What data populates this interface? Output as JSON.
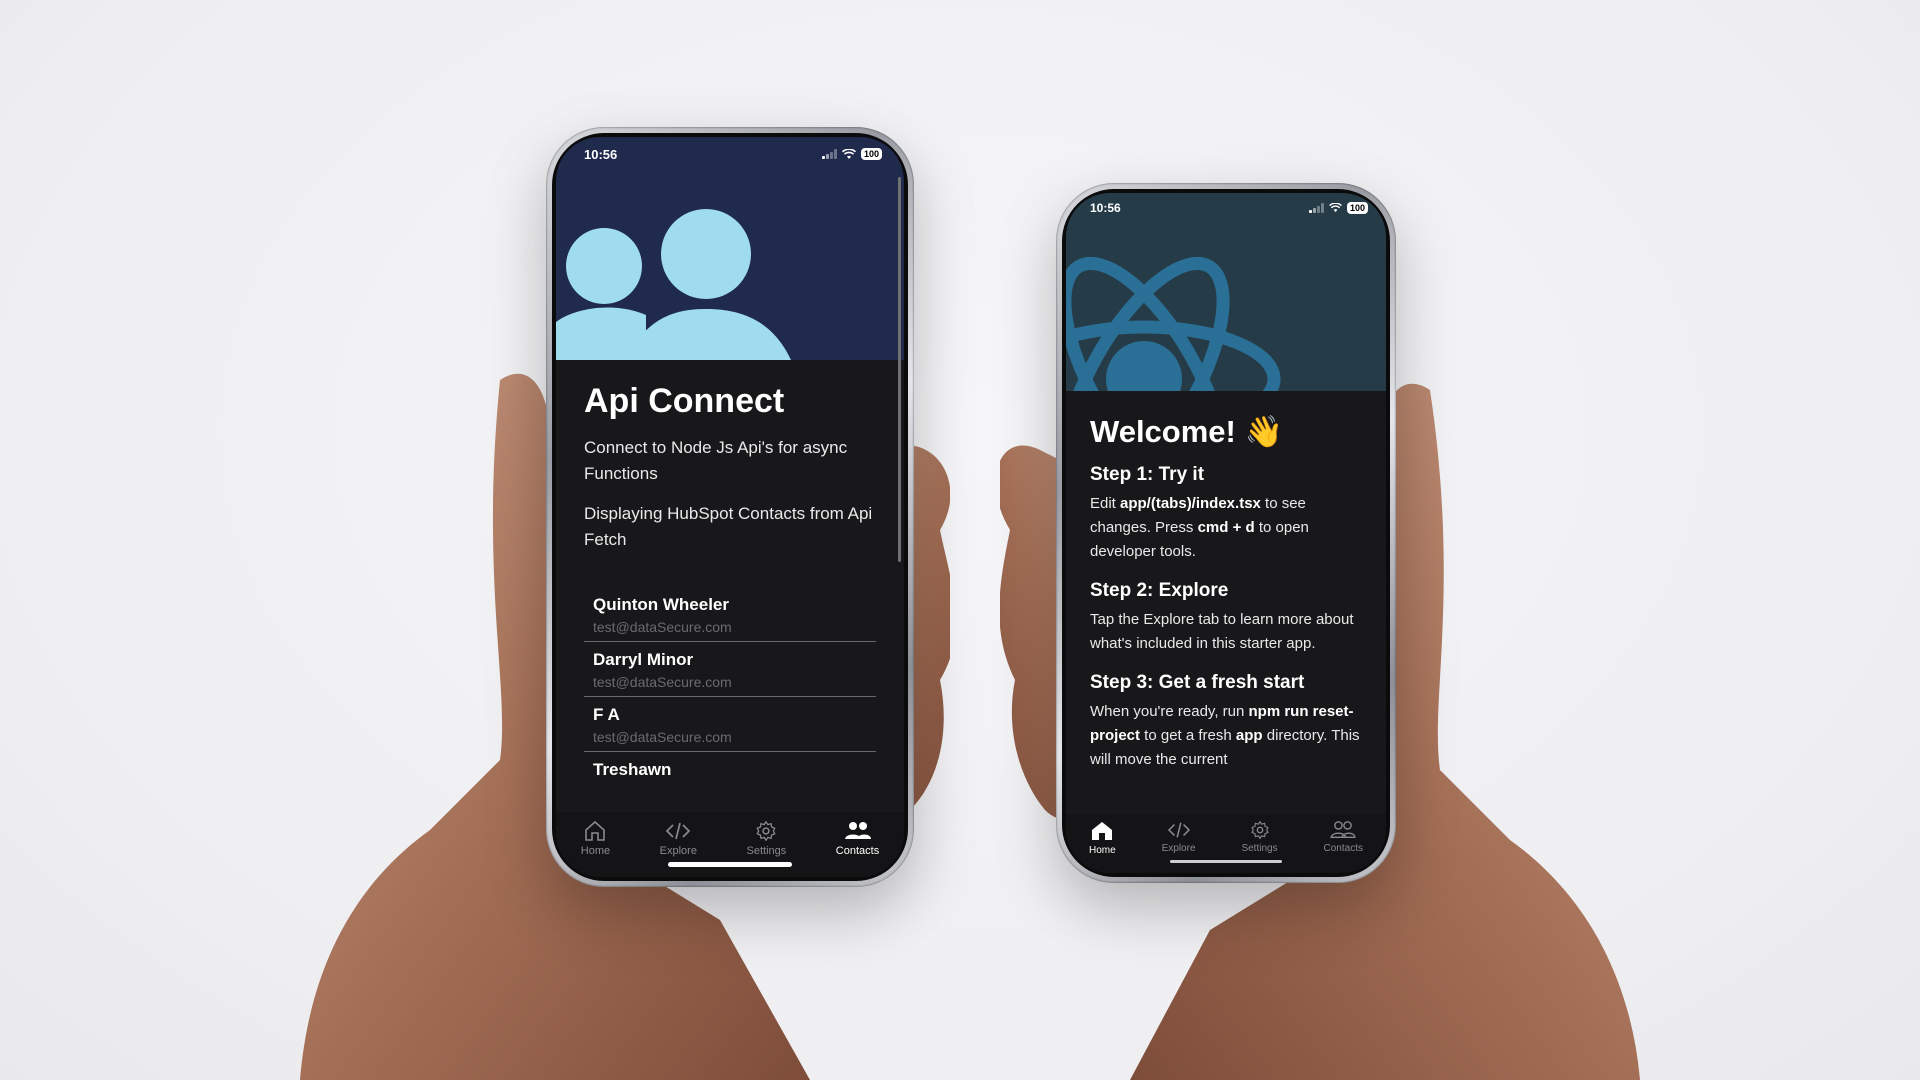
{
  "left_phone": {
    "status": {
      "time": "10:56",
      "battery": "100"
    },
    "title": "Api Connect",
    "description": "Connect to Node Js Api's for async Functions",
    "subtitle": "Displaying HubSpot Contacts from Api Fetch",
    "contacts": [
      {
        "name": "Quinton Wheeler",
        "email": "test@dataSecure.com"
      },
      {
        "name": "Darryl Minor",
        "email": "test@dataSecure.com"
      },
      {
        "name": "F A",
        "email": "test@dataSecure.com"
      },
      {
        "name": "Treshawn",
        "email": ""
      }
    ],
    "tabs": [
      {
        "label": "Home",
        "icon": "home-icon",
        "active": false
      },
      {
        "label": "Explore",
        "icon": "code-icon",
        "active": false
      },
      {
        "label": "Settings",
        "icon": "gear-icon",
        "active": false
      },
      {
        "label": "Contacts",
        "icon": "people-icon",
        "active": true
      }
    ],
    "colors": {
      "header_bg": "#1f2a4d",
      "icon_color": "#9fdcee"
    }
  },
  "right_phone": {
    "status": {
      "time": "10:56",
      "battery": "100"
    },
    "title": "Welcome! 👋",
    "steps": [
      {
        "heading": "Step 1: Try it",
        "t1": "Edit ",
        "b1": "app/(tabs)/index.tsx",
        "t2": " to see changes. Press ",
        "b2": "cmd + d",
        "t3": " to open developer tools."
      },
      {
        "heading": "Step 2: Explore",
        "text": "Tap the Explore tab to learn more about what's included in this starter app."
      },
      {
        "heading": "Step 3: Get a fresh start",
        "t1": "When you're ready, run ",
        "b1": "npm run reset-project",
        "t2": " to get a fresh ",
        "b2": "app",
        "t3": " directory. This will move the current"
      }
    ],
    "tabs": [
      {
        "label": "Home",
        "icon": "home-icon",
        "active": true
      },
      {
        "label": "Explore",
        "icon": "code-icon",
        "active": false
      },
      {
        "label": "Settings",
        "icon": "gear-icon",
        "active": false
      },
      {
        "label": "Contacts",
        "icon": "people-icon",
        "active": false
      }
    ],
    "colors": {
      "header_bg": "#253b47",
      "logo_color": "#2a6f95"
    }
  }
}
